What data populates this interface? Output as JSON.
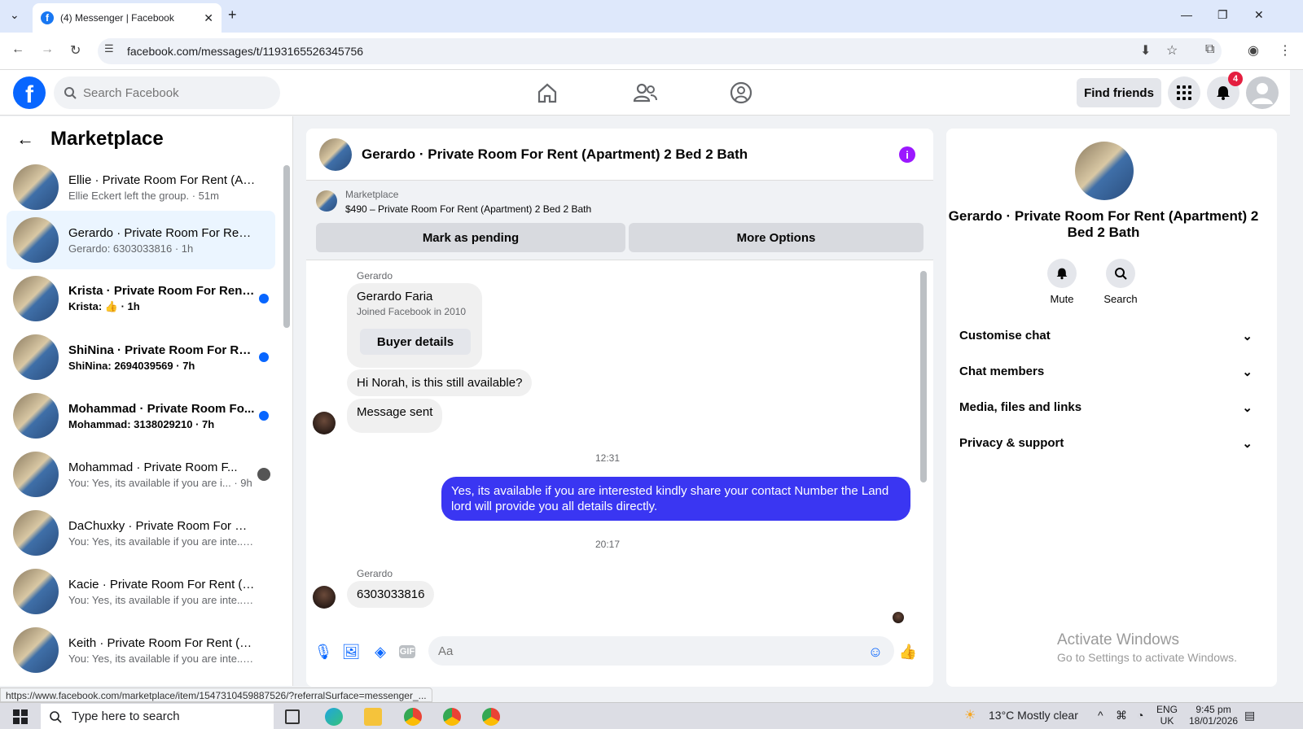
{
  "browser": {
    "tab_title": "(4) Messenger | Facebook",
    "url": "facebook.com/messages/t/1193165526345756",
    "status_url": "https://www.facebook.com/marketplace/item/1547310459887526/?referralSurface=messenger_..."
  },
  "header": {
    "search_placeholder": "Search Facebook",
    "find_friends": "Find friends",
    "notification_count": "4"
  },
  "sidebar": {
    "title": "Marketplace",
    "chats": [
      {
        "name": "Ellie · Private Room For Rent (Ap...",
        "sub": "Ellie Eckert left the group. · 51m",
        "unread": false
      },
      {
        "name": "Gerardo · Private Room For Rent...",
        "sub": "Gerardo: 6303033816 · 1h",
        "unread": false
      },
      {
        "name": "Krista · Private Room For Rent ...",
        "sub": "Krista: 👍 · 1h",
        "unread": true
      },
      {
        "name": "ShiNina · Private Room For Re...",
        "sub": "ShiNina: 2694039569 · 7h",
        "unread": true
      },
      {
        "name": "Mohammad · Private Room Fo...",
        "sub": "Mohammad: 3138029210 · 7h",
        "unread": true
      },
      {
        "name": "Mohammad · Private Room F...",
        "sub": "You: Yes, its available if you are i... · 9h",
        "unread": false
      },
      {
        "name": "DaChuxky · Private Room For Re...",
        "sub": "You: Yes, its available if you are inte... · 9h",
        "unread": false
      },
      {
        "name": "Kacie · Private Room For Rent (A...",
        "sub": "You: Yes, its available if you are inte... · 9h",
        "unread": false
      },
      {
        "name": "Keith · Private Room For Rent (A...",
        "sub": "You: Yes, its available if you are inte... · 9h",
        "unread": false
      }
    ]
  },
  "conversation": {
    "title": "Gerardo · Private Room For Rent (Apartment) 2 Bed 2 Bath",
    "marketplace_label": "Marketplace",
    "listing": "$490 – Private Room For Rent (Apartment) 2 Bed 2 Bath",
    "mark_pending": "Mark as pending",
    "more_options": "More Options",
    "sender1": "Gerardo",
    "buyer_name": "Gerardo Faria",
    "buyer_joined": "Joined Facebook in 2010",
    "buyer_details": "Buyer details",
    "msg1": "Hi Norah, is this still available?",
    "msg2": "Message sent",
    "time1": "12:31",
    "my_msg": "Yes, its available if you are interested kindly share your contact Number the Land lord will provide you all details directly.",
    "time2": "20:17",
    "sender2": "Gerardo",
    "msg3": "6303033816",
    "composer_placeholder": "Aa"
  },
  "right_panel": {
    "title": "Gerardo · Private Room For Rent (Apartment) 2 Bed 2 Bath",
    "mute": "Mute",
    "search": "Search",
    "rows": [
      "Customise chat",
      "Chat members",
      "Media, files and links",
      "Privacy & support"
    ]
  },
  "watermark": {
    "line1": "Activate Windows",
    "line2": "Go to Settings to activate Windows."
  },
  "taskbar": {
    "search_placeholder": "Type here to search",
    "weather": "13°C  Mostly clear",
    "lang1": "ENG",
    "lang2": "UK",
    "time": "9:45 pm",
    "date": "18/01/2026"
  }
}
